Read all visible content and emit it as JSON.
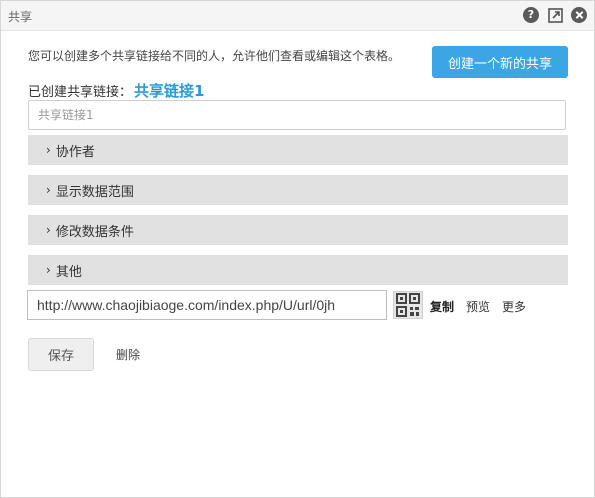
{
  "window": {
    "title": "共享",
    "help_label": "?"
  },
  "intro": {
    "description": "您可以创建多个共享链接给不同的人，允许他们查看或编辑这个表格。",
    "create_button": "创建一个新的共享"
  },
  "share": {
    "created_label": "已创建共享链接：",
    "current_name": "共享链接1",
    "name_placeholder": "共享链接1"
  },
  "sections": [
    {
      "label": "协作者"
    },
    {
      "label": "显示数据范围"
    },
    {
      "label": "修改数据条件"
    },
    {
      "label": "其他"
    }
  ],
  "link": {
    "url": "http://www.chaojibiaoge.com/index.php/U/url/0jh",
    "copy_label": "复制",
    "preview_label": "预览",
    "more_label": "更多"
  },
  "footer": {
    "save_label": "保存",
    "delete_label": "删除"
  },
  "colors": {
    "accent": "#3aa7e4",
    "link_accent": "#2b9bd8",
    "section_bg": "#e1e1e1"
  }
}
